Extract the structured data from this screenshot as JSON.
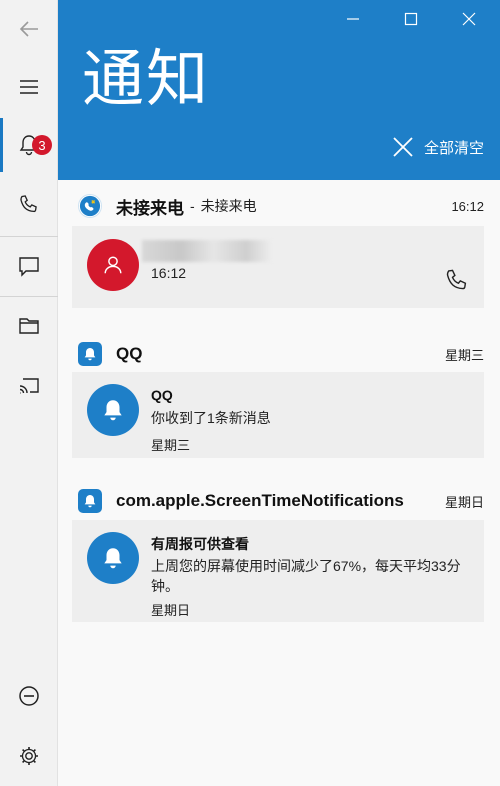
{
  "window": {
    "title": "通知"
  },
  "actions": {
    "clear_all": "全部清空"
  },
  "sidebar": {
    "badge_count": "3"
  },
  "notifications": [
    {
      "app": "未接来电",
      "separator": "-",
      "subtitle": "未接来电",
      "time": "16:12",
      "card": {
        "time": "16:12"
      }
    },
    {
      "app": "QQ",
      "time": "星期三",
      "card": {
        "title": "QQ",
        "body": "你收到了1条新消息",
        "time": "星期三"
      }
    },
    {
      "app": "com.apple.ScreenTimeNotifications",
      "time": "星期日",
      "card": {
        "title": "有周报可供查看",
        "body": "上周您的屏幕使用时间减少了67%，每天平均33分钟。",
        "time": "星期日"
      }
    }
  ],
  "colors": {
    "accent": "#1e7fc8",
    "badge": "#d3182c",
    "avatar_red": "#d3182c"
  },
  "icons": [
    "back-arrow-icon",
    "hamburger-icon",
    "bell-icon",
    "phone-icon",
    "message-icon",
    "folder-icon",
    "cast-icon",
    "do-not-disturb-icon",
    "settings-icon",
    "minimize-icon",
    "maximize-icon",
    "close-icon"
  ]
}
